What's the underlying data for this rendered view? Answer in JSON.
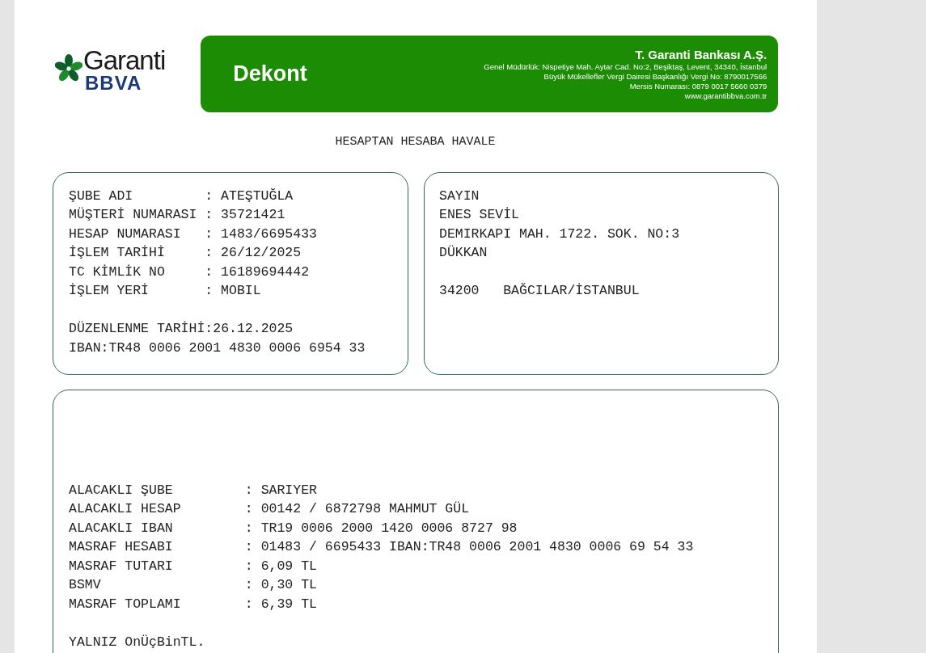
{
  "header": {
    "logo_name": "Garanti",
    "logo_sub": "BBVA",
    "title": "Dekont",
    "bank_name": "T. Garanti Bankası A.Ş.",
    "bank_details": [
      "Genel Müdürlük: Nispetiye Mah. Aytar Cad. No:2, Beşiktaş, Levent, 34340, İstanbul",
      "Büyük Mükellefler Vergi Dairesi Başkanlığı Vergi No: 8790017566",
      "Mersis Numarası: 0879 0017 5660 0379",
      "www.garantibbva.com.tr"
    ]
  },
  "document_title": "HESAPTAN HESABA HAVALE",
  "account_box": {
    "groups": [
      [
        {
          "label": "ŞUBE ADI",
          "value": ": ATEŞTUĞLA"
        },
        {
          "label": "MÜŞTERİ NUMARASI",
          "value": ": 35721421"
        },
        {
          "label": "HESAP NUMARASI",
          "value": ": 1483/6695433"
        },
        {
          "label": "İŞLEM TARİHİ",
          "value": ": 26/12/2025"
        },
        {
          "label": "TC KİMLİK NO",
          "value": ": 16189694442"
        },
        {
          "label": "İŞLEM YERİ",
          "value": ": MOBIL"
        }
      ],
      [
        {
          "label": "DÜZENLENME TARİHİ:26.12.2025"
        },
        {
          "label": "IBAN:TR48 0006 2001 4830 0006 6954 33"
        }
      ]
    ]
  },
  "address_box": {
    "groups": [
      [
        "SAYIN",
        "ENES SEVİL",
        "DEMIRKAPI MAH. 1722. SOK. NO:3",
        "DÜKKAN"
      ],
      [
        "34200   BAĞCILAR/İSTANBUL"
      ]
    ]
  },
  "transfer_box": {
    "groups": [
      [
        {
          "label": "ALACAKLI ŞUBE",
          "value": ": SARIYER"
        },
        {
          "label": "ALACAKLI HESAP",
          "value": ": 00142 / 6872798 MAHMUT GÜL"
        },
        {
          "label": "ALACAKLI IBAN",
          "value": ": TR19 0006 2000 1420 0006 8727 98"
        },
        {
          "label": "MASRAF HESABI",
          "value": ": 01483 / 6695433 IBAN:TR48 0006 2001 4830 0006 69 54 33"
        },
        {
          "label": "MASRAF TUTARI",
          "value": ": 6,09 TL"
        },
        {
          "label": "BSMV",
          "value": ": 0,30 TL"
        },
        {
          "label": "MASRAF TOPLAMI",
          "value": ": 6,39 TL"
        }
      ],
      [
        {
          "label": "YALNIZ OnÜçBinTL."
        }
      ]
    ]
  }
}
